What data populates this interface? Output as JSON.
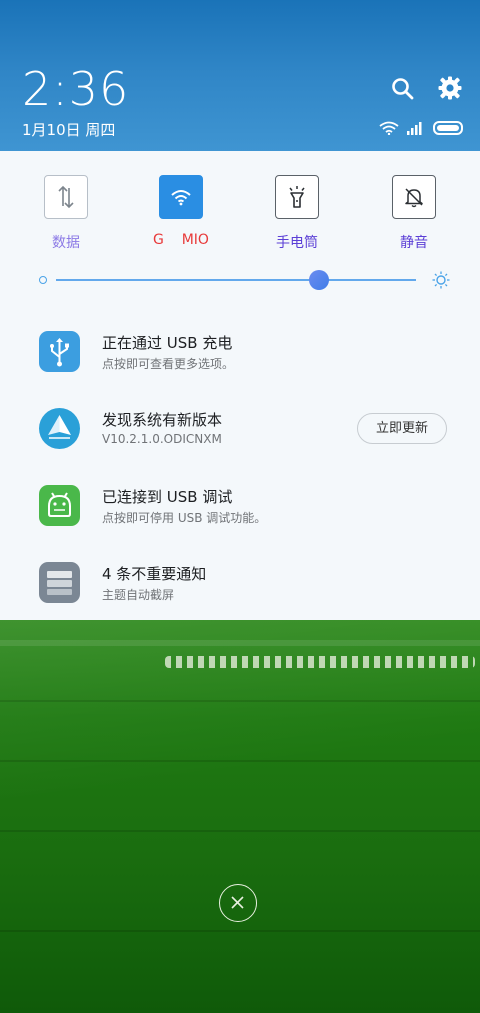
{
  "header": {
    "time": "2:36",
    "date": "1月10日 周四"
  },
  "toggles": [
    {
      "label": "数据",
      "icon": "data-transfer-icon",
      "color": "#8c7ae6",
      "active": false
    },
    {
      "label": "G    MIO",
      "icon": "wifi-icon",
      "color": "#e83a3a",
      "active": true
    },
    {
      "label": "手电筒",
      "icon": "flashlight-icon",
      "color": "#6a4bd8",
      "active": false
    },
    {
      "label": "静音",
      "icon": "bell-mute-icon",
      "color": "#6a4bd8",
      "active": false
    }
  ],
  "brightness": {
    "level": 0.73
  },
  "notifications": [
    {
      "title": "正在通过 USB 充电",
      "subtitle": "点按即可查看更多选项。",
      "icon": "usb-icon"
    },
    {
      "title": "发现系统有新版本",
      "subtitle": "V10.2.1.0.ODICNXM",
      "icon": "update-sail-icon",
      "button": "立即更新"
    },
    {
      "title": "已连接到 USB 调试",
      "subtitle": "点按即可停用 USB 调试功能。",
      "icon": "android-icon"
    },
    {
      "title": "4 条不重要通知",
      "subtitle": "主题自动截屏",
      "icon": "stack-icon"
    }
  ]
}
